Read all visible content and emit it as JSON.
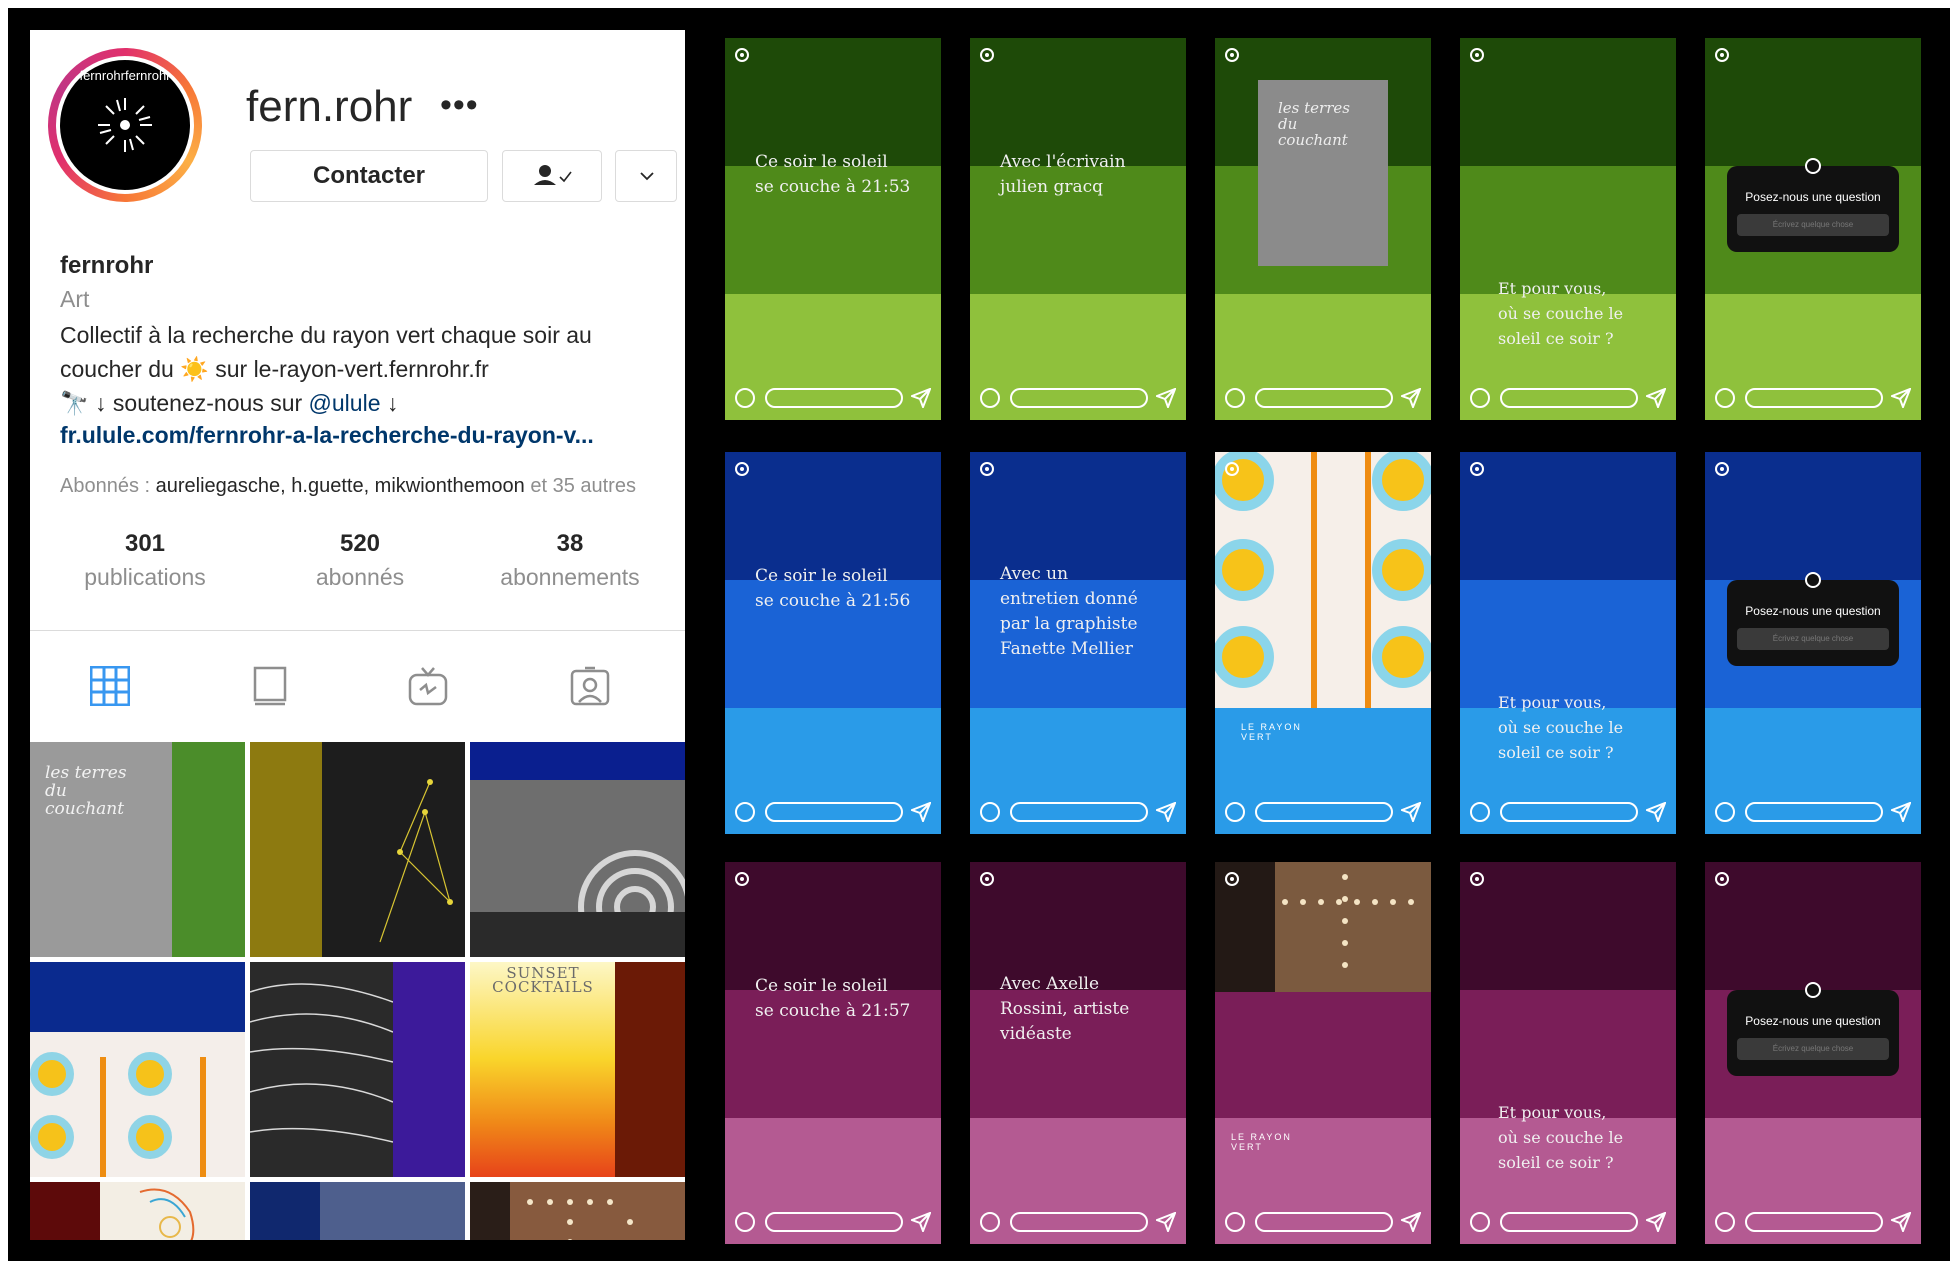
{
  "profile": {
    "username": "fern.rohr",
    "more_label": "•••",
    "contact_label": "Contacter",
    "name": "fernrohr",
    "category": "Art",
    "bio_line1": "Collectif à la recherche du rayon vert chaque soir au",
    "bio_line2_a": "coucher du",
    "bio_line2_b": "sur le-rayon-vert.fernrohr.fr",
    "bio_line3_a": "↓ soutenez-nous sur",
    "bio_mention": "@ulule",
    "bio_line3_b": "↓",
    "bio_url": "fr.ulule.com/fernrohr-a-la-recherche-du-rayon-v...",
    "followers_prefix": "Abonnés :",
    "followers_names": "aureliegasche, h.guette, mikwionthemoon",
    "followers_suffix": "et 35 autres",
    "stats": [
      {
        "num": "301",
        "label": "publications"
      },
      {
        "num": "520",
        "label": "abonnés"
      },
      {
        "num": "38",
        "label": "abonnements"
      }
    ],
    "avatar_text": "fernrohrfernrohr"
  },
  "thumbs": {
    "t1_title": "les terres\ndu\ncouchant",
    "t6_title": "SUNSET\nCOCKTAILS"
  },
  "stories": {
    "row1": [
      "Ce soir le soleil\nse couche à 21:53",
      "Avec l'écrivain\njulien gracq",
      "les terres\ndu\ncouchant",
      "Et pour vous,\noù se couche le\nsoleil ce soir ?",
      "Posez-nous une question"
    ],
    "row2": [
      "Ce soir le soleil\nse couche à 21:56",
      "Avec un\nentretien donné\npar la graphiste\nFanette Mellier",
      "",
      "Et pour vous,\noù se couche le\nsoleil ce soir ?",
      "Posez-nous une question"
    ],
    "row3": [
      "Ce soir le soleil\nse couche à 21:57",
      "Avec Axelle\nRossini, artiste\nvidéaste",
      "",
      "Et pour vous,\noù se couche le\nsoleil ce soir ?",
      "Posez-nous une question"
    ],
    "question_placeholder": "Écrivez quelque chose",
    "badge_text": "LE RAYON VERT"
  },
  "colors": {
    "green": [
      "#1e4a08",
      "#4f8a1a",
      "#8fc13c"
    ],
    "blue": [
      "#0a2e8e",
      "#1a63d6",
      "#2a9be8"
    ],
    "magenta": [
      "#3e0a2c",
      "#7a1e58",
      "#b45a92"
    ]
  }
}
